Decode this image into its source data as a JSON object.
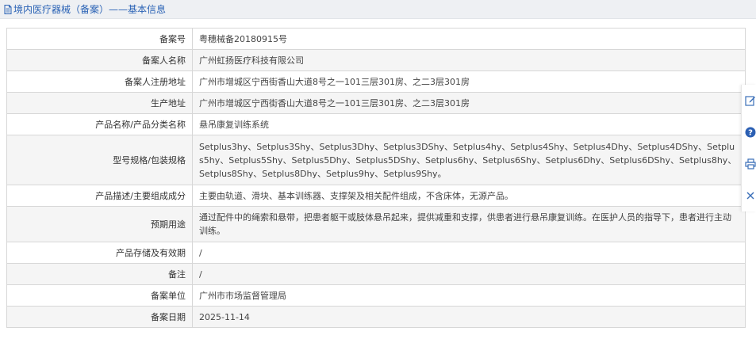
{
  "header": {
    "title": "境内医疗器械（备案）——基本信息",
    "icon": "document-icon",
    "color": "#2a62b5"
  },
  "rows": [
    {
      "label": "备案号",
      "value": "粤穗械备20180915号"
    },
    {
      "label": "备案人名称",
      "value": "广州虹扬医疗科技有限公司"
    },
    {
      "label": "备案人注册地址",
      "value": "广州市增城区宁西街香山大道8号之一101三层301房、之二3层301房"
    },
    {
      "label": "生产地址",
      "value": "广州市增城区宁西街香山大道8号之一101三层301房、之二3层301房"
    },
    {
      "label": "产品名称/产品分类名称",
      "value": "悬吊康复训练系统"
    },
    {
      "label": "型号规格/包装规格",
      "value": "Setplus3hy、Setplus3Shy、Setplus3Dhy、Setplus3DShy、Setplus4hy、Setplus4Shy、Setplus4Dhy、Setplus4DShy、Setplus5hy、Setplus5Shy、Setplus5Dhy、Setplus5DShy、Setplus6hy、Setplus6Shy、Setplus6Dhy、Setplus6DShy、Setplus8hy、Setplus8Shy、Setplus8Dhy、Setplus9hy、Setplus9Shy。"
    },
    {
      "label": "产品描述/主要组成成分",
      "value": "主要由轨道、滑块、基本训练器、支撑架及相关配件组成，不含床体，无源产品。"
    },
    {
      "label": "预期用途",
      "value": "通过配件中的绳索和悬带，把患者躯干或肢体悬吊起来，提供减重和支撑，供患者进行悬吊康复训练。在医护人员的指导下，患者进行主动训练。"
    },
    {
      "label": "产品存储及有效期",
      "value": "/"
    },
    {
      "label": "备注",
      "value": "/"
    },
    {
      "label": "备案单位",
      "value": "广州市市场监督管理局"
    },
    {
      "label": "备案日期",
      "value": "2025-11-14"
    }
  ],
  "side_tools": [
    "edit-icon",
    "help-icon",
    "print-icon",
    "close-icon"
  ]
}
